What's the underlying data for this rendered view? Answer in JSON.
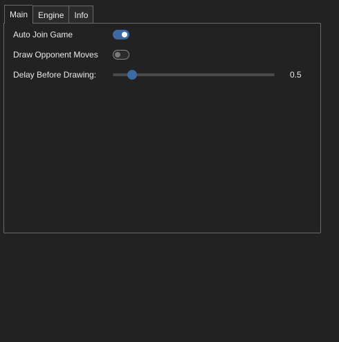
{
  "tabs": [
    {
      "label": "Main",
      "active": true
    },
    {
      "label": "Engine",
      "active": false
    },
    {
      "label": "Info",
      "active": false
    }
  ],
  "settings": {
    "auto_join": {
      "label": "Auto Join Game",
      "enabled": true
    },
    "draw_opponent": {
      "label": "Draw Opponent Moves",
      "enabled": false
    },
    "delay": {
      "label": "Delay Before Drawing:",
      "value": "0.5",
      "fraction": 0.12
    }
  },
  "colors": {
    "accent": "#3d6aa3",
    "background": "#222222",
    "border": "#6b6b6b"
  }
}
